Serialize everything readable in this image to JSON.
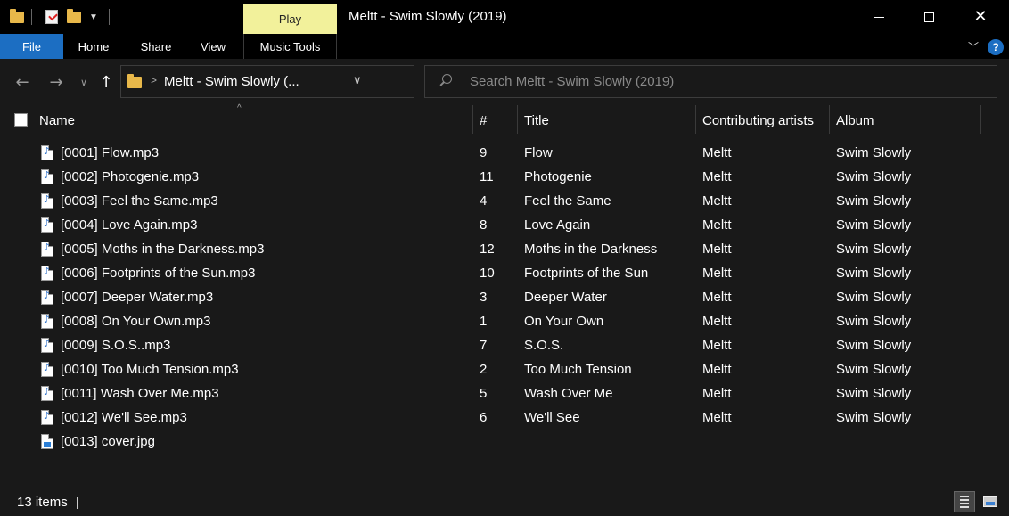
{
  "window": {
    "title": "Meltt - Swim Slowly (2019)",
    "context_tab": "Play"
  },
  "ribbon": {
    "tabs": [
      "File",
      "Home",
      "Share",
      "View",
      "Music Tools"
    ],
    "help_label": "?"
  },
  "address": {
    "path": "Meltt - Swim Slowly (...",
    "search_placeholder": "Search Meltt - Swim Slowly (2019)"
  },
  "columns": {
    "name": "Name",
    "number": "#",
    "title": "Title",
    "artists": "Contributing artists",
    "album": "Album"
  },
  "files": [
    {
      "name": "[0001] Flow.mp3",
      "number": "9",
      "title": "Flow",
      "artist": "Meltt",
      "album": "Swim Slowly",
      "type": "mp3"
    },
    {
      "name": "[0002] Photogenie.mp3",
      "number": "11",
      "title": "Photogenie",
      "artist": "Meltt",
      "album": "Swim Slowly",
      "type": "mp3"
    },
    {
      "name": "[0003] Feel the Same.mp3",
      "number": "4",
      "title": "Feel the Same",
      "artist": "Meltt",
      "album": "Swim Slowly",
      "type": "mp3"
    },
    {
      "name": "[0004] Love Again.mp3",
      "number": "8",
      "title": "Love Again",
      "artist": "Meltt",
      "album": "Swim Slowly",
      "type": "mp3"
    },
    {
      "name": "[0005] Moths in the Darkness.mp3",
      "number": "12",
      "title": "Moths in the Darkness",
      "artist": "Meltt",
      "album": "Swim Slowly",
      "type": "mp3"
    },
    {
      "name": "[0006] Footprints of the Sun.mp3",
      "number": "10",
      "title": "Footprints of the Sun",
      "artist": "Meltt",
      "album": "Swim Slowly",
      "type": "mp3"
    },
    {
      "name": "[0007] Deeper Water.mp3",
      "number": "3",
      "title": "Deeper Water",
      "artist": "Meltt",
      "album": "Swim Slowly",
      "type": "mp3"
    },
    {
      "name": "[0008] On Your Own.mp3",
      "number": "1",
      "title": "On Your Own",
      "artist": "Meltt",
      "album": "Swim Slowly",
      "type": "mp3"
    },
    {
      "name": "[0009] S.O.S..mp3",
      "number": "7",
      "title": "S.O.S.",
      "artist": "Meltt",
      "album": "Swim Slowly",
      "type": "mp3"
    },
    {
      "name": "[0010] Too Much Tension.mp3",
      "number": "2",
      "title": "Too Much Tension",
      "artist": "Meltt",
      "album": "Swim Slowly",
      "type": "mp3"
    },
    {
      "name": "[0011] Wash Over Me.mp3",
      "number": "5",
      "title": "Wash Over Me",
      "artist": "Meltt",
      "album": "Swim Slowly",
      "type": "mp3"
    },
    {
      "name": "[0012] We'll See.mp3",
      "number": "6",
      "title": "We'll See",
      "artist": "Meltt",
      "album": "Swim Slowly",
      "type": "mp3"
    },
    {
      "name": "[0013] cover.jpg",
      "number": "",
      "title": "",
      "artist": "",
      "album": "",
      "type": "jpg"
    }
  ],
  "status": {
    "item_count": "13 items"
  },
  "colors": {
    "accent": "#1c6ec2",
    "context_tab": "#f2f19b",
    "background": "#191919"
  }
}
